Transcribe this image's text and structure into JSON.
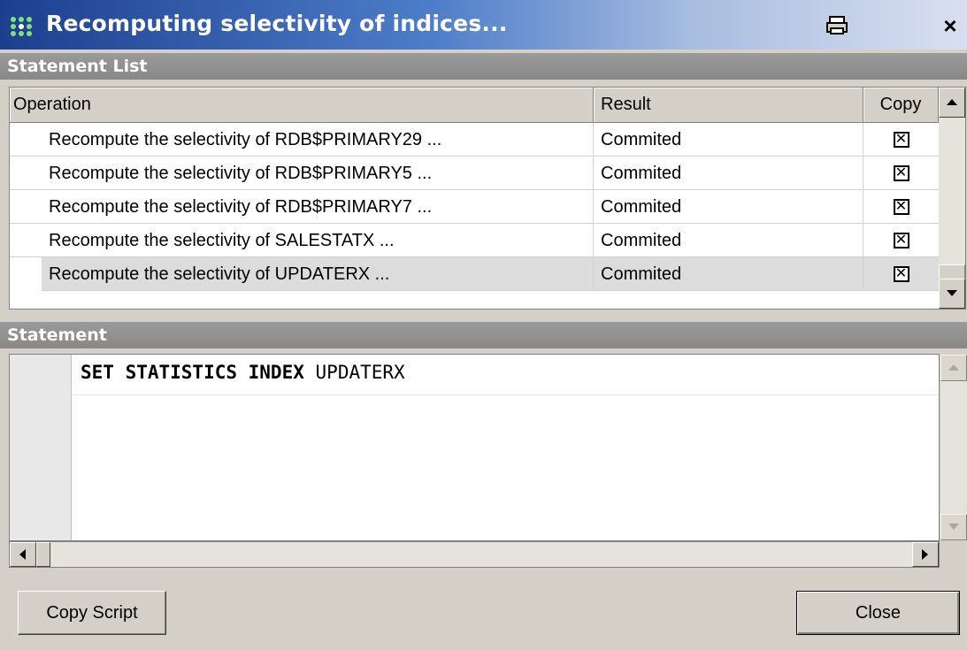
{
  "window": {
    "title": "Recomputing selectivity of indices...",
    "icons": {
      "app": "grid-dots-icon",
      "print": "printer-icon",
      "close": "close-icon"
    },
    "close_glyph": "×"
  },
  "statement_list": {
    "header": "Statement List",
    "columns": {
      "operation": "Operation",
      "result": "Result",
      "copy": "Copy"
    },
    "rows": [
      {
        "operation": "Recompute the selectivity of RDB$PRIMARY29 ...",
        "result": "Commited",
        "copy": "☒"
      },
      {
        "operation": "Recompute the selectivity of RDB$PRIMARY5 ...",
        "result": "Commited",
        "copy": "☒"
      },
      {
        "operation": "Recompute the selectivity of RDB$PRIMARY7 ...",
        "result": "Commited",
        "copy": "☒"
      },
      {
        "operation": "Recompute the selectivity of SALESTATX ...",
        "result": "Commited",
        "copy": "☒"
      },
      {
        "operation": "Recompute the selectivity of UPDATERX ...",
        "result": "Commited",
        "copy": "☒"
      }
    ],
    "selected_row": 4
  },
  "statement": {
    "header": "Statement",
    "keywords": "SET STATISTICS INDEX",
    "identifier": "UPDATERX"
  },
  "buttons": {
    "copy_script": "Copy Script",
    "close": "Close"
  },
  "colors": {
    "title_gradient_start": "#1c3f8e",
    "section_header": "#9a9a9a",
    "face": "#d4d0c8"
  }
}
